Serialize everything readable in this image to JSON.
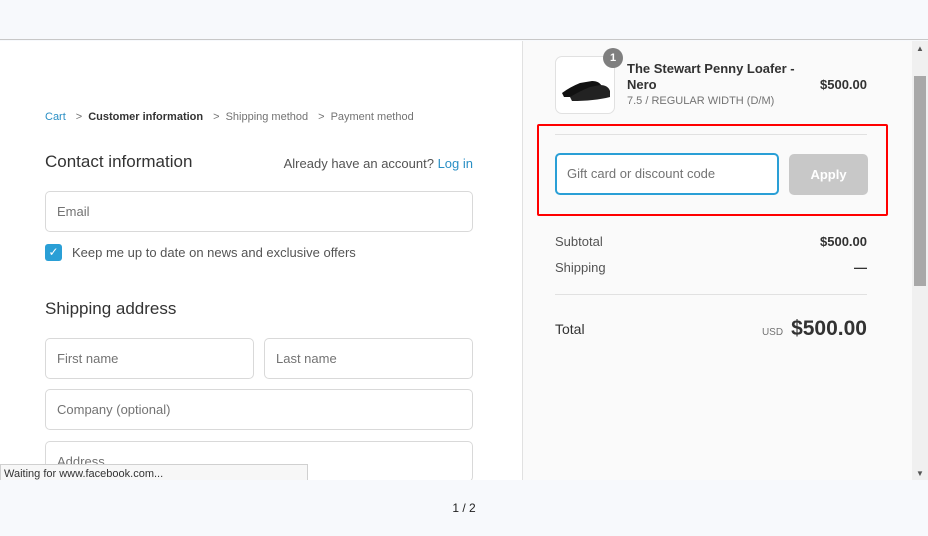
{
  "breadcrumb": {
    "cart": "Cart",
    "customer": "Customer information",
    "shipping": "Shipping method",
    "payment": "Payment method",
    "sep": ">"
  },
  "contact": {
    "title": "Contact information",
    "account_prompt": "Already have an account?",
    "login": "Log in",
    "email_placeholder": "Email",
    "newsletter_label": "Keep me up to date on news and exclusive offers",
    "newsletter_checked": true
  },
  "shipping": {
    "title": "Shipping address",
    "first_name": "First name",
    "last_name": "Last name",
    "company": "Company (optional)",
    "address": "Address"
  },
  "status_bar": "Waiting for www.facebook.com...",
  "pager": "1 / 2",
  "order": {
    "quantity": "1",
    "product_name": "The Stewart Penny Loafer - Nero",
    "variant": "7.5 / REGULAR WIDTH (D/M)",
    "price": "$500.00",
    "discount_placeholder": "Gift card or discount code",
    "apply": "Apply",
    "subtotal_label": "Subtotal",
    "subtotal": "$500.00",
    "shipping_label": "Shipping",
    "shipping_value": "—",
    "total_label": "Total",
    "currency": "USD",
    "total": "$500.00"
  },
  "colors": {
    "accent": "#2a9fd6",
    "highlight": "#ff0000"
  }
}
